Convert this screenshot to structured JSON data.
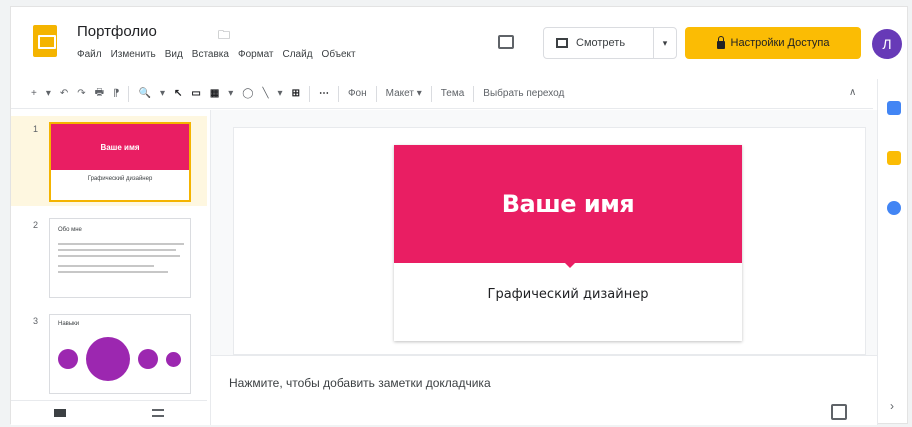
{
  "app": {
    "title": "Портфолио",
    "logo_icon": "slides-logo-icon",
    "folder_icon": "folder-icon"
  },
  "menu": [
    "Файл",
    "Изменить",
    "Вид",
    "Вставка",
    "Формат",
    "Слайд",
    "Объект"
  ],
  "header": {
    "present_label": "Смотреть",
    "present_dropdown": "▾",
    "share_label": "Настройки Доступа",
    "avatar_letter": "Л"
  },
  "toolbar": {
    "items": [
      "+",
      "▾",
      "↶",
      "↷",
      "🖶",
      "⁋",
      "🔍",
      "▾",
      "↖",
      "▭",
      "▦",
      "▾",
      "◯",
      "╲",
      "▾",
      "⊞",
      "⋯"
    ],
    "background": "Фон",
    "layout": "Макет ▾",
    "theme": "Тема",
    "transition": "Выбрать переход",
    "collapse": "∧"
  },
  "filmstrip": {
    "slides": [
      {
        "num": "1",
        "title": "Ваше имя",
        "subtitle": "Графический дизайнер"
      },
      {
        "num": "2",
        "title": "Обо мне"
      },
      {
        "num": "3",
        "title": "Навыки"
      }
    ]
  },
  "slide": {
    "title": "Ваше имя",
    "subtitle": "Графический дизайнер"
  },
  "notes": {
    "placeholder": "Нажмите, чтобы добавить заметки докладчика"
  },
  "colors": {
    "brand": "#fbbc04",
    "accent": "#e91e63",
    "avatar": "#673ab7",
    "purple": "#9c27b0"
  }
}
